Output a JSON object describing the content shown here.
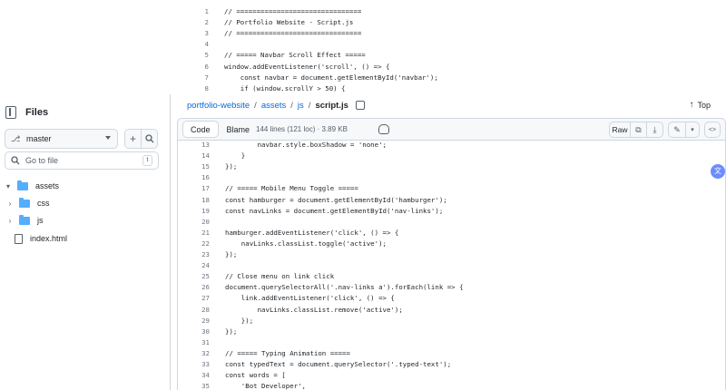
{
  "top_code": {
    "lines": [
      {
        "n": "1",
        "t": "// ==============================="
      },
      {
        "n": "2",
        "t": "// Portfolio Website - Script.js"
      },
      {
        "n": "3",
        "t": "// ==============================="
      },
      {
        "n": "4",
        "t": ""
      },
      {
        "n": "5",
        "t": "// ===== Navbar Scroll Effect ====="
      },
      {
        "n": "6",
        "t": "window.addEventListener('scroll', () => {"
      },
      {
        "n": "7",
        "t": "    const navbar = document.getElementById('navbar');"
      },
      {
        "n": "8",
        "t": "    if (window.scrollY > 50) {"
      }
    ]
  },
  "sidebar": {
    "title": "Files",
    "branch": "master",
    "goto_placeholder": "Go to file",
    "goto_shortcut": "t",
    "tree": [
      {
        "label": "assets",
        "type": "folder",
        "expanded": true
      },
      {
        "label": "css",
        "type": "folder",
        "expanded": false
      },
      {
        "label": "js",
        "type": "folder",
        "expanded": false
      },
      {
        "label": "index.html",
        "type": "file"
      }
    ]
  },
  "breadcrumb": {
    "repo": "portfolio-website",
    "sep": "/",
    "p1": "assets",
    "p2": "js",
    "file": "script.js",
    "top_label": "Top"
  },
  "toolbar": {
    "code_label": "Code",
    "blame_label": "Blame",
    "meta": "144 lines (121 loc) · 3.89 KB",
    "raw_label": "Raw"
  },
  "code": {
    "lines": [
      {
        "n": "13",
        "t": "        navbar.style.boxShadow = 'none';"
      },
      {
        "n": "14",
        "t": "    }"
      },
      {
        "n": "15",
        "t": "});"
      },
      {
        "n": "16",
        "t": ""
      },
      {
        "n": "17",
        "t": "// ===== Mobile Menu Toggle ====="
      },
      {
        "n": "18",
        "t": "const hamburger = document.getElementById('hamburger');"
      },
      {
        "n": "19",
        "t": "const navLinks = document.getElementById('nav-links');"
      },
      {
        "n": "20",
        "t": ""
      },
      {
        "n": "21",
        "t": "hamburger.addEventListener('click', () => {"
      },
      {
        "n": "22",
        "t": "    navLinks.classList.toggle('active');"
      },
      {
        "n": "23",
        "t": "});"
      },
      {
        "n": "24",
        "t": ""
      },
      {
        "n": "25",
        "t": "// Close menu on link click"
      },
      {
        "n": "26",
        "t": "document.querySelectorAll('.nav-links a').forEach(link => {"
      },
      {
        "n": "27",
        "t": "    link.addEventListener('click', () => {"
      },
      {
        "n": "28",
        "t": "        navLinks.classList.remove('active');"
      },
      {
        "n": "29",
        "t": "    });"
      },
      {
        "n": "30",
        "t": "});"
      },
      {
        "n": "31",
        "t": ""
      },
      {
        "n": "32",
        "t": "// ===== Typing Animation ====="
      },
      {
        "n": "33",
        "t": "const typedText = document.querySelector('.typed-text');"
      },
      {
        "n": "34",
        "t": "const words = ["
      },
      {
        "n": "35",
        "t": "    'Bot Developer',"
      }
    ]
  },
  "colors": {
    "link": "#0969da",
    "folder": "#54aeff",
    "comment": "#6e7781",
    "border": "#d0d7de",
    "translate_badge": "#6c8cff"
  },
  "icons": {
    "sidebar_toggle": "sidebar-collapse-icon",
    "branch": "git-branch-icon",
    "add": "plus-icon",
    "search": "search-icon",
    "copy": "copy-icon",
    "top": "arrow-up-icon",
    "copilot": "copilot-icon",
    "download": "download-icon",
    "edit": "pencil-icon",
    "symbols": "code-square-icon",
    "translate": "translate-icon"
  }
}
